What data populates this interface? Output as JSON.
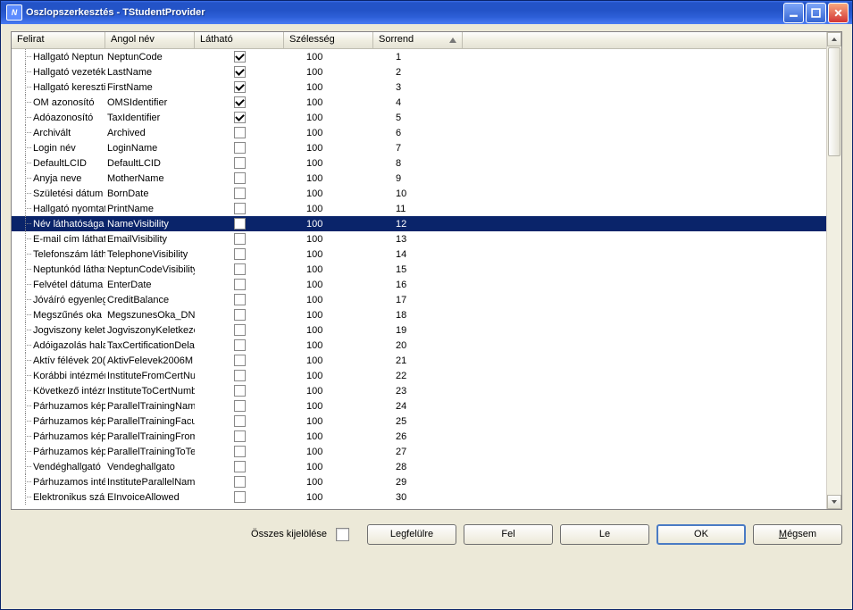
{
  "title": "Oszlopszerkesztés - TStudentProvider",
  "columns": {
    "felirat": "Felirat",
    "angol": "Angol név",
    "lathato": "Látható",
    "szelesseg": "Szélesség",
    "sorrend": "Sorrend"
  },
  "bottom": {
    "select_all": "Összes kijelölése",
    "top": "Legfelülre",
    "up": "Fel",
    "down": "Le",
    "ok": "OK",
    "cancel_prefix": "M",
    "cancel_rest": "égsem"
  },
  "selected_index": 11,
  "rows": [
    {
      "felirat": "Hallgató Neptun",
      "angol": "NeptunCode",
      "lathato": true,
      "szel": "100",
      "sor": "1"
    },
    {
      "felirat": "Hallgató vezeték",
      "angol": "LastName",
      "lathato": true,
      "szel": "100",
      "sor": "2"
    },
    {
      "felirat": "Hallgató kereszti",
      "angol": "FirstName",
      "lathato": true,
      "szel": "100",
      "sor": "3"
    },
    {
      "felirat": "OM azonosító",
      "angol": "OMSIdentifier",
      "lathato": true,
      "szel": "100",
      "sor": "4"
    },
    {
      "felirat": "Adóazonosító",
      "angol": "TaxIdentifier",
      "lathato": true,
      "szel": "100",
      "sor": "5"
    },
    {
      "felirat": "Archivált",
      "angol": "Archived",
      "lathato": false,
      "szel": "100",
      "sor": "6"
    },
    {
      "felirat": "Login név",
      "angol": "LoginName",
      "lathato": false,
      "szel": "100",
      "sor": "7"
    },
    {
      "felirat": "DefaultLCID",
      "angol": "DefaultLCID",
      "lathato": false,
      "szel": "100",
      "sor": "8"
    },
    {
      "felirat": "Anyja neve",
      "angol": "MotherName",
      "lathato": false,
      "szel": "100",
      "sor": "9"
    },
    {
      "felirat": "Születési dátum",
      "angol": "BornDate",
      "lathato": false,
      "szel": "100",
      "sor": "10"
    },
    {
      "felirat": "Hallgató nyomtat",
      "angol": "PrintName",
      "lathato": false,
      "szel": "100",
      "sor": "11"
    },
    {
      "felirat": "Név láthatósága",
      "angol": "NameVisibility",
      "lathato": false,
      "szel": "100",
      "sor": "12"
    },
    {
      "felirat": "E-mail cím láthat",
      "angol": "EmailVisibility",
      "lathato": false,
      "szel": "100",
      "sor": "13"
    },
    {
      "felirat": "Telefonszám láth",
      "angol": "TelephoneVisibility",
      "lathato": false,
      "szel": "100",
      "sor": "14"
    },
    {
      "felirat": "Neptunkód láthat",
      "angol": "NeptunCodeVisibility",
      "lathato": false,
      "szel": "100",
      "sor": "15"
    },
    {
      "felirat": "Felvétel dátuma",
      "angol": "EnterDate",
      "lathato": false,
      "szel": "100",
      "sor": "16"
    },
    {
      "felirat": "Jóváíró egyenleg",
      "angol": "CreditBalance",
      "lathato": false,
      "szel": "100",
      "sor": "17"
    },
    {
      "felirat": "Megszűnés oka",
      "angol": "MegszunesOka_DN",
      "lathato": false,
      "szel": "100",
      "sor": "18"
    },
    {
      "felirat": "Jogviszony kelet",
      "angol": "JogviszonyKeletkeze",
      "lathato": false,
      "szel": "100",
      "sor": "19"
    },
    {
      "felirat": "Adóigazolás hala",
      "angol": "TaxCertificationDela",
      "lathato": false,
      "szel": "100",
      "sor": "20"
    },
    {
      "felirat": "Aktív félévek 20(",
      "angol": "AktivFelevek2006M",
      "lathato": false,
      "szel": "100",
      "sor": "21"
    },
    {
      "felirat": "Korábbi intézmén",
      "angol": "InstituteFromCertNum",
      "lathato": false,
      "szel": "100",
      "sor": "22"
    },
    {
      "felirat": "Következő intézn",
      "angol": "InstituteToCertNumb",
      "lathato": false,
      "szel": "100",
      "sor": "23"
    },
    {
      "felirat": "Párhuzamos kép:",
      "angol": "ParallelTrainingName",
      "lathato": false,
      "szel": "100",
      "sor": "24"
    },
    {
      "felirat": "Párhuzamos kép:",
      "angol": "ParallelTrainingFacu",
      "lathato": false,
      "szel": "100",
      "sor": "25"
    },
    {
      "felirat": "Párhuzamos kép:",
      "angol": "ParallelTrainingFrom",
      "lathato": false,
      "szel": "100",
      "sor": "26"
    },
    {
      "felirat": "Párhuzamos kép:",
      "angol": "ParallelTrainingToTe",
      "lathato": false,
      "szel": "100",
      "sor": "27"
    },
    {
      "felirat": "Vendéghallgató",
      "angol": "Vendeghallgato",
      "lathato": false,
      "szel": "100",
      "sor": "28"
    },
    {
      "felirat": "Párhuzamos inté:",
      "angol": "InstituteParallelName",
      "lathato": false,
      "szel": "100",
      "sor": "29"
    },
    {
      "felirat": "Elektronikus szár",
      "angol": "EInvoiceAllowed",
      "lathato": false,
      "szel": "100",
      "sor": "30"
    }
  ]
}
